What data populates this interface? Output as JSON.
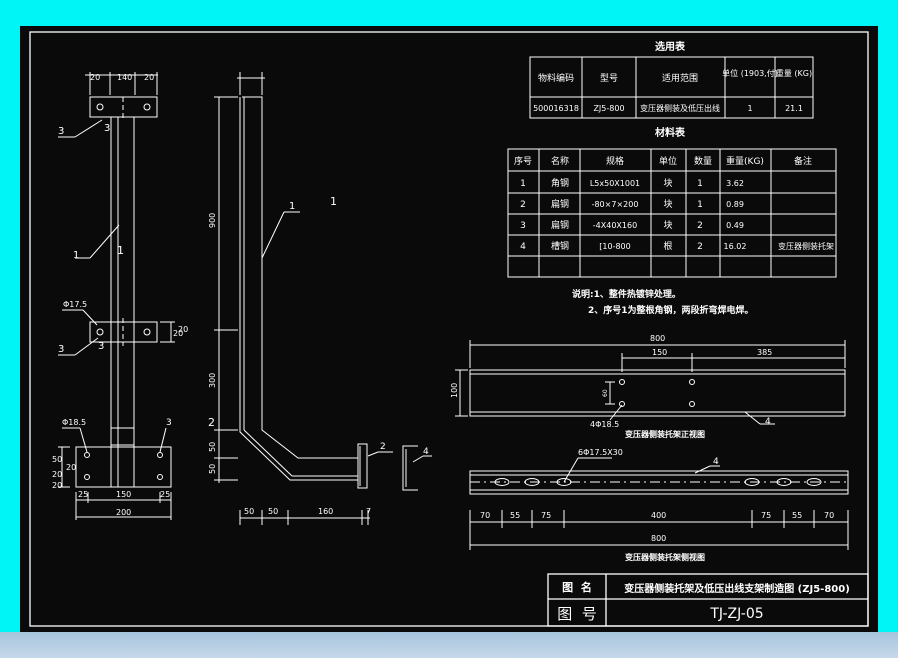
{
  "selection_table": {
    "title": "选用表",
    "headers": [
      "物料编码",
      "型号",
      "适用范围",
      "单位\n(1903,付)",
      "重量\n(KG)"
    ],
    "row": [
      "500016318",
      "ZJ5-800",
      "变压器侧装及低压出线",
      "1",
      "21.1"
    ]
  },
  "material_table": {
    "title": "材料表",
    "headers": [
      "序号",
      "名称",
      "规格",
      "单位",
      "数量",
      "重量(KG)",
      "备注"
    ],
    "rows": [
      [
        "1",
        "角钢",
        "L5x50X1001",
        "块",
        "1",
        "3.62",
        ""
      ],
      [
        "2",
        "扁钢",
        "-80×7×200",
        "块",
        "1",
        "0.89",
        ""
      ],
      [
        "3",
        "扁钢",
        "-4X40X160",
        "块",
        "2",
        "0.49",
        ""
      ],
      [
        "4",
        "槽钢",
        "[10-800",
        "根",
        "2",
        "16.02",
        "变压器侧装托架"
      ]
    ]
  },
  "notes": [
    "说明:1、整件热镀锌处理。",
    "2、序号1为整根角钢，两段折弯焊电焊。"
  ],
  "front_view": {
    "dims": [
      "20",
      "140",
      "20",
      "Φ17.5",
      "Φ18.5",
      "20",
      "25",
      "150",
      "25",
      "200",
      "20",
      "50",
      "20",
      "20",
      "20"
    ],
    "labels": [
      "1",
      "1",
      "3",
      "3",
      "3",
      "3",
      "3"
    ]
  },
  "side_view": {
    "dims": [
      "900",
      "300",
      "50",
      "50",
      "50",
      "50",
      "160",
      "7"
    ],
    "labels": [
      "1",
      "1",
      "2",
      "2",
      "4"
    ]
  },
  "channel_top": {
    "dims": [
      "800",
      "150",
      "385",
      "100",
      "60"
    ],
    "hole_label": "4Φ18.5",
    "leader": "4",
    "caption": "变压器侧装托架正视图"
  },
  "channel_bottom": {
    "hole_label": "6Φ17.5X30",
    "leader": "4",
    "dims": [
      "70",
      "55",
      "75",
      "400",
      "75",
      "55",
      "70",
      "800"
    ],
    "caption": "变压器侧装托架侧视图"
  },
  "title_block": {
    "name_label": "图  名",
    "name_value": "变压器侧装托架及低压出线支架制造图 (ZJ5-800)",
    "number_label": "图  号",
    "number_value": "TJ-ZJ-05"
  },
  "colors": {
    "frame": "#00f6f6",
    "background": "#0a0a0a",
    "lines": "#ffffff",
    "text": "#ffffff"
  }
}
